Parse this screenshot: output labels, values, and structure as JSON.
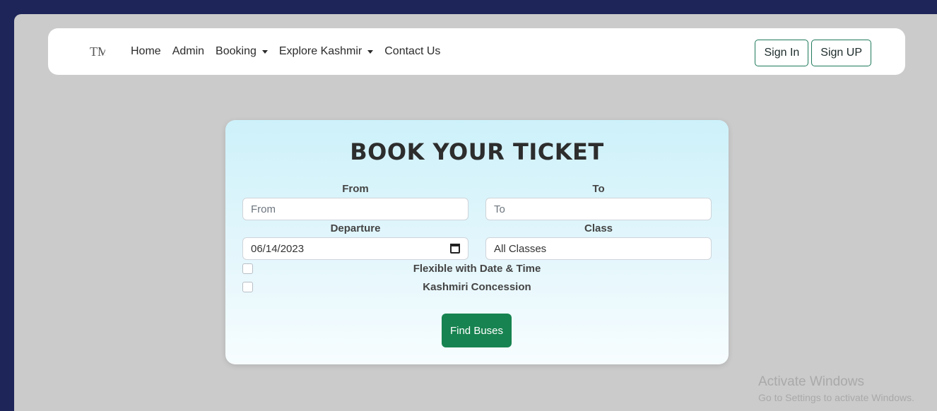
{
  "navbar": {
    "logo_text": "TM",
    "links": [
      {
        "label": "Home"
      },
      {
        "label": "Admin"
      },
      {
        "label": "Booking"
      },
      {
        "label": "Explore Kashmir"
      },
      {
        "label": "Contact Us"
      }
    ],
    "sign_in_label": "Sign In",
    "sign_up_label": "Sign UP"
  },
  "booking": {
    "title": "BOOK YOUR TICKET",
    "from_label": "From",
    "from_placeholder": "From",
    "to_label": "To",
    "to_placeholder": "To",
    "departure_label": "Departure",
    "departure_value": "06/14/2023",
    "class_label": "Class",
    "class_value": "All Classes",
    "flexible_label": "Flexible with Date & Time",
    "flexible_checked": false,
    "concession_label": "Kashmiri Concession",
    "concession_checked": false,
    "submit_label": "Find Buses"
  },
  "watermark": {
    "title": "Activate Windows",
    "subtitle": "Go to Settings to activate Windows."
  },
  "colors": {
    "outer_background": "#1e2559",
    "page_background": "#cbcbcb",
    "button_green": "#178350",
    "outline_green": "#1f7a5a",
    "card_gradient_top": "#cdf1fa"
  }
}
